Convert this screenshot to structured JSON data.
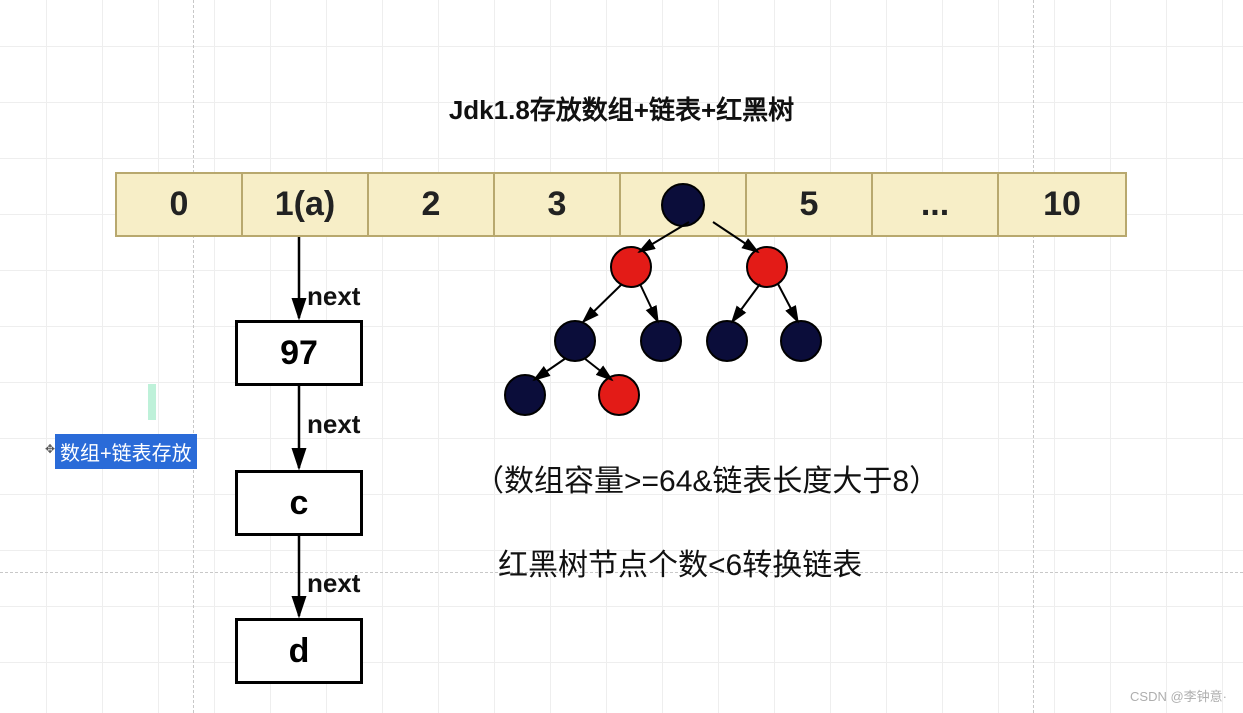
{
  "title": "Jdk1.8存放数组+链表+红黑树",
  "array": {
    "cells": [
      "0",
      "1(a)",
      "2",
      "3",
      "",
      "5",
      "...",
      "10"
    ],
    "tree_index": 4
  },
  "linked_list": {
    "next_label": "next",
    "nodes": [
      "97",
      "c",
      "d"
    ]
  },
  "highlight_box": "数组+链表存放",
  "notes": {
    "cond": "（数组容量>=64&链表长度大于8）",
    "rule": "红黑树节点个数<6转换链表"
  },
  "tree": {
    "colors": {
      "root": "black",
      "l": "red",
      "r": "red",
      "ll": "black",
      "lr": "black",
      "rl": "black",
      "rr": "black",
      "lll": "black",
      "llr": "red"
    }
  },
  "watermark": "CSDN @李钟意·"
}
